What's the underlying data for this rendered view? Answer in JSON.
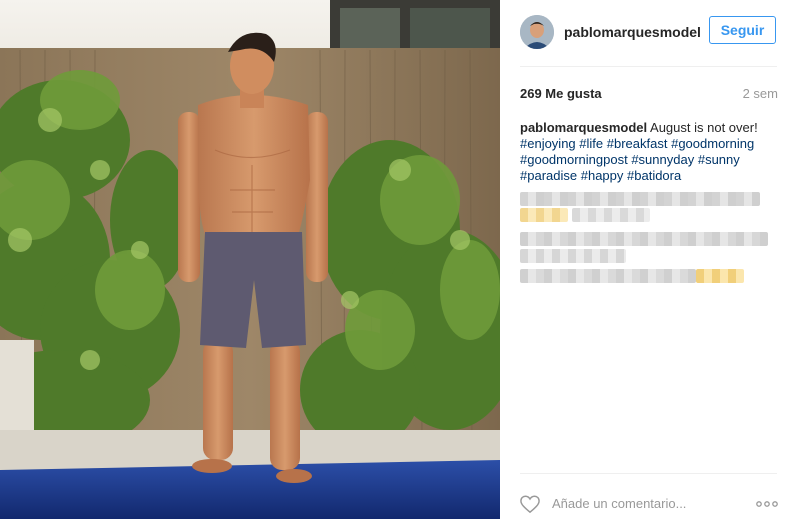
{
  "post": {
    "username": "pablomarquesmodel",
    "follow_label": "Seguir",
    "likes": "269 Me gusta",
    "time_ago": "2 sem",
    "caption_user": "pablomarquesmodel",
    "caption_text": " August is not over!",
    "hashtags": [
      "#enjoying",
      "#life",
      "#breakfast",
      "#goodmorning",
      "#goodmorningpost",
      "#sunnyday",
      "#sunny",
      "#paradise",
      "#happy",
      "#batidora"
    ],
    "comment_placeholder": "Añade un comentario...",
    "icons": [
      "heart-icon",
      "more-options-icon"
    ]
  },
  "colors": {
    "follow_blue": "#3897f0",
    "hashtag": "#003569",
    "muted": "#999999"
  }
}
